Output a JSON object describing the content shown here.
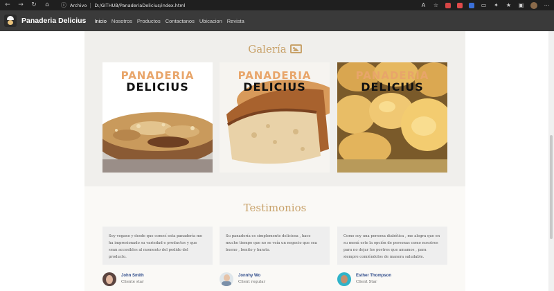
{
  "browser": {
    "scheme_label": "Archivo",
    "url": "D:/GITHUB/PanaderiaDelicius/index.html",
    "extension_colors": [
      "#d64545",
      "#e04a4a",
      "#3a6fd8"
    ]
  },
  "navbar": {
    "brand": "Panaderia Delicius",
    "items": [
      {
        "label": "Inicio",
        "active": true
      },
      {
        "label": "Nosotros"
      },
      {
        "label": "Productos"
      },
      {
        "label": "Contactanos"
      },
      {
        "label": "Ubicacion"
      },
      {
        "label": "Revista"
      }
    ]
  },
  "gallery": {
    "title": "Galería",
    "icon": "image-icon",
    "cards": [
      {
        "line1": "PANADERIA",
        "line2": "DELICIUS",
        "image": "pie-crumble-image"
      },
      {
        "line1": "PANADERIA",
        "line2": "DELICIUS",
        "image": "bread-loaf-image"
      },
      {
        "line1": "PANADERIA",
        "line2": "DELICIUS",
        "image": "bread-rolls-image"
      }
    ]
  },
  "testimonials": {
    "title": "Testimonios",
    "items": [
      {
        "text": "Soy vegano y desde que conocí esta panadería me ha impresionado su variedad e productos y que sean accesibles al momento del pedido del producto.",
        "name": "John Smith",
        "role": "Cliente star"
      },
      {
        "text": "Su panadería es simplemente deliciosa , hace mucho tiempo que no se veía un negocio que sea bueno , bonito y barato.",
        "name": "Jonnhy Wo",
        "role": "Client regular"
      },
      {
        "text": "Como soy una persona diabética , me alegra que en su menú este la opción de personas como nosotros para no dejar los postres que amamos , para siempre comiéndolos de manera saludable.",
        "name": "Esther Thompson",
        "role": "Client Star"
      }
    ]
  },
  "colors": {
    "accent": "#c8a26a",
    "navbar": "#3a3a3a",
    "section_bg": "#f0efec",
    "name_link": "#2d4a8a"
  }
}
